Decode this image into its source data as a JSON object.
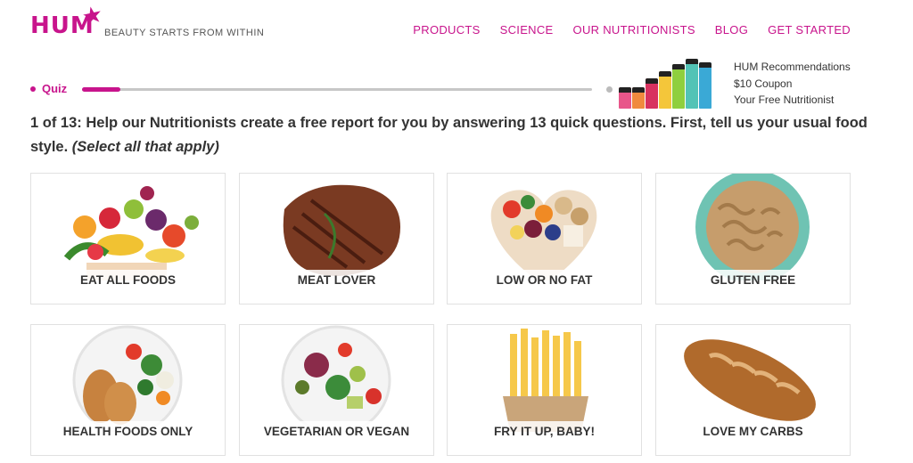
{
  "header": {
    "logo_text": "HUM",
    "tagline": "BEAUTY STARTS FROM WITHIN",
    "nav": [
      "PRODUCTS",
      "SCIENCE",
      "OUR NUTRITIONISTS",
      "BLOG",
      "GET STARTED"
    ]
  },
  "progress": {
    "label": "Quiz",
    "fraction": 0.075
  },
  "rewards": [
    "HUM Recommendations",
    "$10 Coupon",
    "Your Free Nutritionist"
  ],
  "question": {
    "text": "1 of 13: Help our Nutritionists create a free report for you by answering 13 quick questions. First, tell us your usual food style.",
    "hint": "(Select all that apply)"
  },
  "options": [
    {
      "label": "EAT ALL FOODS",
      "icon": "fruit-vegetable-pile-icon"
    },
    {
      "label": "MEAT LOVER",
      "icon": "steak-icon"
    },
    {
      "label": "LOW OR NO FAT",
      "icon": "heart-bowl-icon"
    },
    {
      "label": "GLUTEN FREE",
      "icon": "pasta-bowl-icon"
    },
    {
      "label": "HEALTH FOODS ONLY",
      "icon": "chicken-salad-plate-icon"
    },
    {
      "label": "VEGETARIAN OR VEGAN",
      "icon": "vegetable-plate-icon"
    },
    {
      "label": "FRY IT UP, BABY!",
      "icon": "french-fries-icon"
    },
    {
      "label": "LOVE MY CARBS",
      "icon": "bread-loaf-icon"
    }
  ],
  "colors": {
    "accent": "#c8148c",
    "track": "#c7c7c7",
    "text": "#333333"
  }
}
